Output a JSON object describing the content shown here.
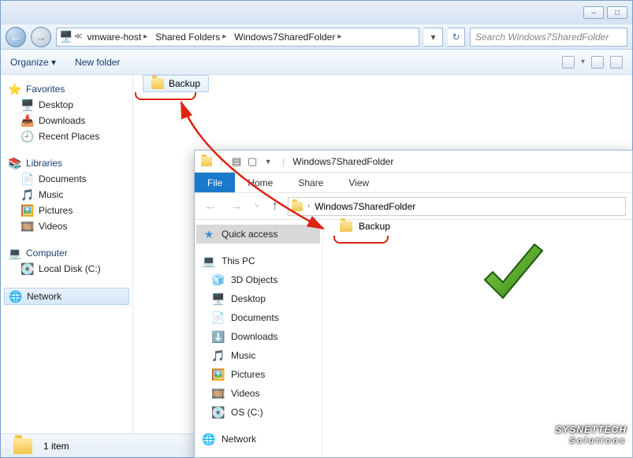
{
  "win7": {
    "titlebar": {
      "min": "–",
      "max": "□"
    },
    "nav": {
      "back": "←",
      "fwd": "→"
    },
    "breadcrumbs": [
      "vmware-host",
      "Shared Folders",
      "Windows7SharedFolder"
    ],
    "refresh": "↻",
    "search_placeholder": "Search Windows7SharedFolder",
    "toolbar": {
      "organize": "Organize ▾",
      "newfolder": "New folder"
    },
    "sidebar": {
      "favorites": {
        "label": "Favorites",
        "items": [
          "Desktop",
          "Downloads",
          "Recent Places"
        ]
      },
      "libraries": {
        "label": "Libraries",
        "items": [
          "Documents",
          "Music",
          "Pictures",
          "Videos"
        ]
      },
      "computer": {
        "label": "Computer",
        "items": [
          "Local Disk (C:)"
        ]
      },
      "network": {
        "label": "Network"
      }
    },
    "content": {
      "folder": "Backup"
    },
    "status": "1 item"
  },
  "win10": {
    "title": "Windows7SharedFolder",
    "ribbon": {
      "file": "File",
      "home": "Home",
      "share": "Share",
      "view": "View"
    },
    "breadcrumbs": [
      "Windows7SharedFolder"
    ],
    "sidebar": {
      "quickaccess": "Quick access",
      "thispc": {
        "label": "This PC",
        "items": [
          "3D Objects",
          "Desktop",
          "Documents",
          "Downloads",
          "Music",
          "Pictures",
          "Videos",
          "OS (C:)"
        ]
      },
      "network": "Network"
    },
    "content": {
      "folder": "Backup"
    }
  },
  "watermark": {
    "line1": "SYSNETTECH",
    "line2": "Solutions"
  }
}
